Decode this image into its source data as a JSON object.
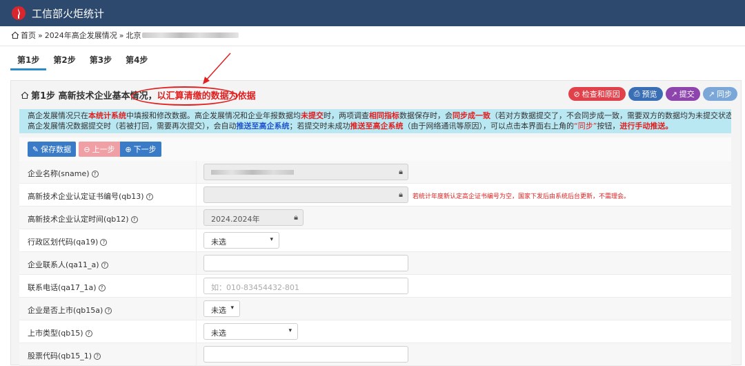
{
  "app": {
    "title": "工信部火炬统计"
  },
  "breadcrumb": {
    "home": "首页",
    "sep": "»",
    "section": "2024年高企发展情况",
    "region": "北京"
  },
  "tabs": [
    {
      "label": "第1步",
      "active": true
    },
    {
      "label": "第2步",
      "active": false
    },
    {
      "label": "第3步",
      "active": false
    },
    {
      "label": "第4步",
      "active": false
    }
  ],
  "panel": {
    "title_prefix": "第1步 高新技术企业基本情况",
    "title_comma": "，",
    "title_highlight": "以汇算清缴的数据为依据",
    "buttons": {
      "check": "检查和原因",
      "preview": "预览",
      "submit": "提交",
      "sync": "同步"
    }
  },
  "notice": {
    "l1_a": "高企发展情况只在",
    "l1_b": "本统计系统",
    "l1_c": "中填报和修改数据。高企发展情况和企业年报数据均",
    "l1_d": "未提交",
    "l1_e": "时，两项调查",
    "l1_f": "相同指标",
    "l1_g": "数据保存时，会",
    "l1_h": "同步成一致",
    "l1_i": "（若对方数据提交了，不会同步成一致，需要双方的数据均为未提交状态，才会同步）。",
    "l2_a": "高企发展情况数据提交时（若被打回，需要再次提交），会自动",
    "l2_b": "推送至高企系统",
    "l2_c": "；若提交时未成功",
    "l2_d": "推送至高企系统",
    "l2_e": "（由于网络通讯等原因），可以点击本界面右上角的",
    "l2_f": "“同步”",
    "l2_g": "按钮，",
    "l2_h": "进行手动推送。"
  },
  "actions": {
    "save": "保存数据",
    "prev": "上一步",
    "next": "下一步"
  },
  "form": {
    "sname_label": "企业名称(sname)",
    "qb13_label": "高新技术企业认定证书编号(qb13)",
    "qb13_hint": "若统计年度新认定高企证书编号为空，国家下发后由系统后台更新，不需理会。",
    "qb12_label": "高新技术企业认定时间(qb12)",
    "qb12_value": "2024.2024年",
    "qa19_label": "行政区划代码(qa19)",
    "qa19_value": "未选",
    "qa11a_label": "企业联系人(qa11_a)",
    "qa11a_value": "",
    "qa17_label": "联系电话(qa17_1a)",
    "qa17_placeholder": "如：010-83454432-801",
    "qb15a_label": "企业是否上市(qb15a)",
    "qb15a_value": "未选",
    "qb15_label": "上市类型(qb15)",
    "qb15_value": "未选",
    "qb151_label": "股票代码(qb15_1)",
    "qb151_value": ""
  },
  "icons": {
    "logo": "torch-logo-icon",
    "home": "home-icon",
    "lock": "lock-icon",
    "help": "question-circle-icon"
  },
  "colors": {
    "topbar": "#2d4a6e",
    "notice_bg": "#b9e7f2",
    "accent_red": "#e02020",
    "primary_blue": "#3a7bc8"
  }
}
